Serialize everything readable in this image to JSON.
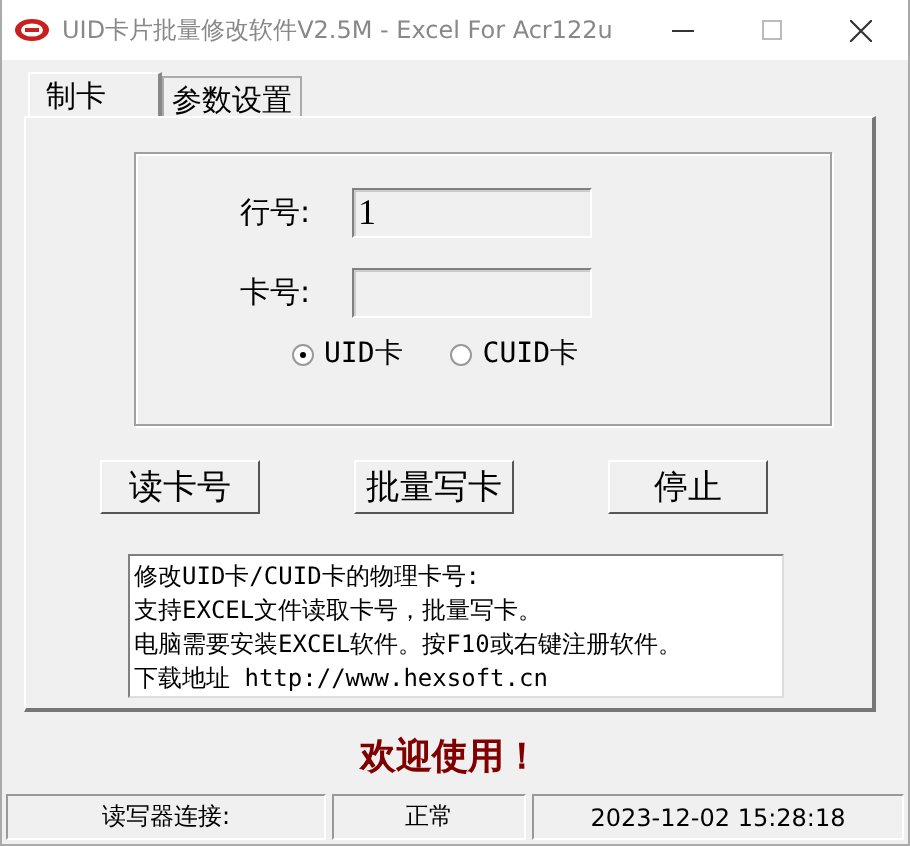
{
  "window": {
    "title": "UID卡片批量修改软件V2.5M - Excel For Acr122u"
  },
  "tabs": [
    {
      "label": "制卡",
      "selected": true
    },
    {
      "label": "参数设置",
      "selected": false
    }
  ],
  "fields": [
    {
      "label": "行号:",
      "value": "1"
    },
    {
      "label": "卡号:"
    }
  ],
  "card_types": [
    {
      "label": "UID卡",
      "selected": true
    },
    {
      "label": "CUID卡",
      "selected": false
    }
  ],
  "buttons": [
    "读卡号",
    "批量写卡",
    "停止"
  ],
  "info_lines": [
    "修改UID卡/CUID卡的物理卡号:",
    "支持EXCEL文件读取卡号，批量写卡。",
    "电脑需要安装EXCEL软件。按F10或右键注册软件。",
    "下载地址 http://www.hexsoft.cn"
  ],
  "welcome": "欢迎使用！",
  "status_bar": [
    "读写器连接:",
    "正常",
    "2023-12-02 15:28:18"
  ]
}
